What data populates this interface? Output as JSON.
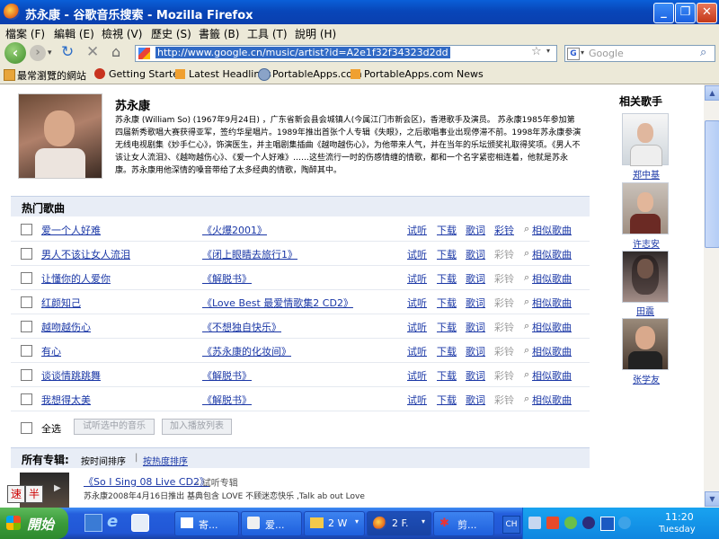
{
  "window": {
    "title": "苏永康 - 谷歌音乐搜索 - Mozilla Firefox",
    "minimize": "_",
    "restore": "❐",
    "close": "✕"
  },
  "menu": [
    "檔案 (F)",
    "編輯 (E)",
    "檢視 (V)",
    "歷史 (S)",
    "書籤 (B)",
    "工具 (T)",
    "說明 (H)"
  ],
  "nav": {
    "url": "http://www.google.cn/music/artist?id=A2e1f32f34323d2dd",
    "search_placeholder": "Google"
  },
  "bookmarks": [
    "最常瀏覽的網站",
    "Getting Started",
    "Latest Headlines",
    "PortableApps.com",
    "PortableApps.com News"
  ],
  "artist": {
    "name": "苏永康",
    "bio": "苏永康 (William So) (1967年9月24日) ，广东省新会县会城镇人(今属江门市新会区)，香港歌手及演员。 苏永康1985年参加第四届新秀歌唱大赛获得亚军，签约华星唱片。1989年推出首张个人专辑《失眼》，之后歌唱事业出现停滞不前。1998年苏永康参演无线电视剧集《妙手仁心》，饰演医生，并主唱剧集插曲《越吻越伤心》，为他带来人气，并在当年的乐坛颁奖礼取得奖项。《男人不该让女人流泪》、《越吻越伤心》、《爱一个人好难》……这些流行一时的伤感情缠的情歌，都和一个名字紧密相连着，他就是苏永康。苏永康用他深情的嗓音带给了太多经典的情歌，陶醉其中。"
  },
  "hot_songs": {
    "heading": "热门歌曲",
    "actions": {
      "listen": "试听",
      "download": "下载",
      "lyrics": "歌词",
      "ringtone": "彩铃",
      "similar": "相似歌曲"
    },
    "rows": [
      {
        "song": "爱一个人好难",
        "album": "《火爆2001》",
        "ringtone_active": true
      },
      {
        "song": "男人不该让女人流泪",
        "album": "《闭上眼睛去旅行1》",
        "ringtone_active": false
      },
      {
        "song": "让懂你的人爱你",
        "album": "《解脱书》",
        "ringtone_active": false
      },
      {
        "song": "红颜知己",
        "album": "《Love Best 最爱情歌集2 CD2》",
        "ringtone_active": false
      },
      {
        "song": "越吻越伤心",
        "album": "《不想独自快乐》",
        "ringtone_active": false
      },
      {
        "song": "有心",
        "album": "《苏永康的化妆间》",
        "ringtone_active": false
      },
      {
        "song": "谈谈情跳跳舞",
        "album": "《解脱书》",
        "ringtone_active": false
      },
      {
        "song": "我想得太美",
        "album": "《解脱书》",
        "ringtone_active": false
      }
    ],
    "select_all": "全选",
    "btn_listen_selected": "试听选中的音乐",
    "btn_add_playlist": "加入播放列表"
  },
  "albums": {
    "heading": "所有专辑:",
    "sort_by_time": "按时间排序",
    "separator": "|",
    "sort_by_heat": "按热度排序",
    "first_album": "《So I Sing 08 Live CD2》",
    "first_album_action": "- 试听专辑",
    "first_album_desc": "苏永康2008年4月16日推出 基典包含 LOVE 不顾迷恋快乐 ,Talk ab out Love"
  },
  "related": {
    "heading": "相关歌手",
    "artists": [
      "郑中基",
      "许志安",
      "田震",
      "张学友"
    ]
  },
  "ime": {
    "a": "速",
    "b": "半"
  },
  "taskbar": {
    "start": "開始",
    "buttons": [
      "寄...",
      "爱...",
      "2 W",
      "2 F.",
      "剪..."
    ],
    "lang": "CH",
    "time": "11:20",
    "day": "Tuesday"
  },
  "colors": {
    "section_bg": "#e8edf6",
    "link": "#1a37a6",
    "title_bar": "#0a4fc8",
    "taskbar": "#245edc"
  }
}
